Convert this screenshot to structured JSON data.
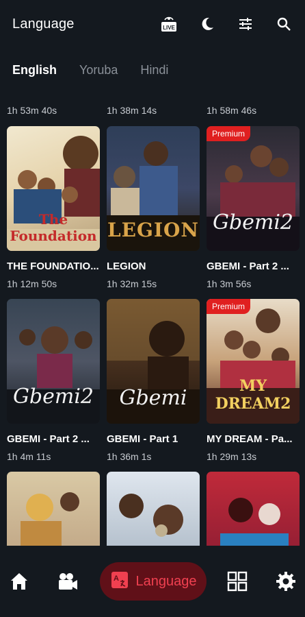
{
  "header": {
    "title": "Language",
    "live_badge": "LIVE",
    "icons": [
      "live-icon",
      "moon-icon",
      "sliders-icon",
      "search-icon"
    ]
  },
  "tabs": [
    {
      "label": "English",
      "active": true
    },
    {
      "label": "Yoruba",
      "active": false
    },
    {
      "label": "Hindi",
      "active": false
    }
  ],
  "top_durations": [
    "1h 53m 40s",
    "1h 38m 14s",
    "1h 58m 46s"
  ],
  "movies": [
    {
      "title": "THE FOUNDATIO...",
      "duration": "1h 12m 50s",
      "premium": false,
      "poster_text": "The Foundation"
    },
    {
      "title": "LEGION",
      "duration": "1h 32m 15s",
      "premium": false,
      "poster_text": "LEGION"
    },
    {
      "title": "GBEMI - Part 2 ...",
      "duration": "1h 3m 56s",
      "premium": true,
      "badge": "Premium",
      "poster_text": "Gbemi2"
    },
    {
      "title": "GBEMI - Part 2 ...",
      "duration": "1h 4m 11s",
      "premium": false,
      "poster_text": "Gbemi2"
    },
    {
      "title": "GBEMI - Part 1",
      "duration": "1h 36m 1s",
      "premium": false,
      "poster_text": "Gbemi"
    },
    {
      "title": "MY DREAM - Pa...",
      "duration": "1h 29m 13s",
      "premium": true,
      "badge": "Premium",
      "poster_text": "MY DREAM2"
    }
  ],
  "bottom_nav": {
    "active_label": "Language",
    "active_glyph": "A",
    "icons": [
      "home-icon",
      "camera-icon",
      "language-icon",
      "grid-icon",
      "settings-icon"
    ]
  },
  "colors": {
    "background": "#14191f",
    "accent": "#e02020",
    "pill_bg": "#601018",
    "pill_text": "#f04050"
  }
}
